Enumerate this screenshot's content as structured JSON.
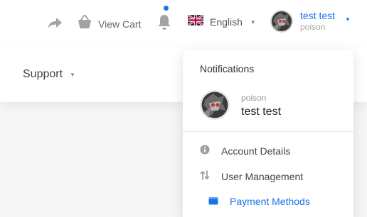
{
  "header": {
    "view_cart_label": "View Cart",
    "language_label": "English",
    "user_name": "test test",
    "user_sub": "poison"
  },
  "nav": {
    "support_label": "Support"
  },
  "dropdown": {
    "title": "Notifications",
    "profile_sub": "poison",
    "profile_name": "test test",
    "items": [
      {
        "label": "Account Details",
        "icon": "info-icon"
      },
      {
        "label": "User Management",
        "icon": "sort-arrows-icon"
      },
      {
        "label": "Payment Methods",
        "icon": "wallet-icon",
        "active": true
      }
    ]
  },
  "colors": {
    "accent": "#1a73e8",
    "icon_gray": "#9e9e9e",
    "notification_dot": "#1a73e8"
  }
}
